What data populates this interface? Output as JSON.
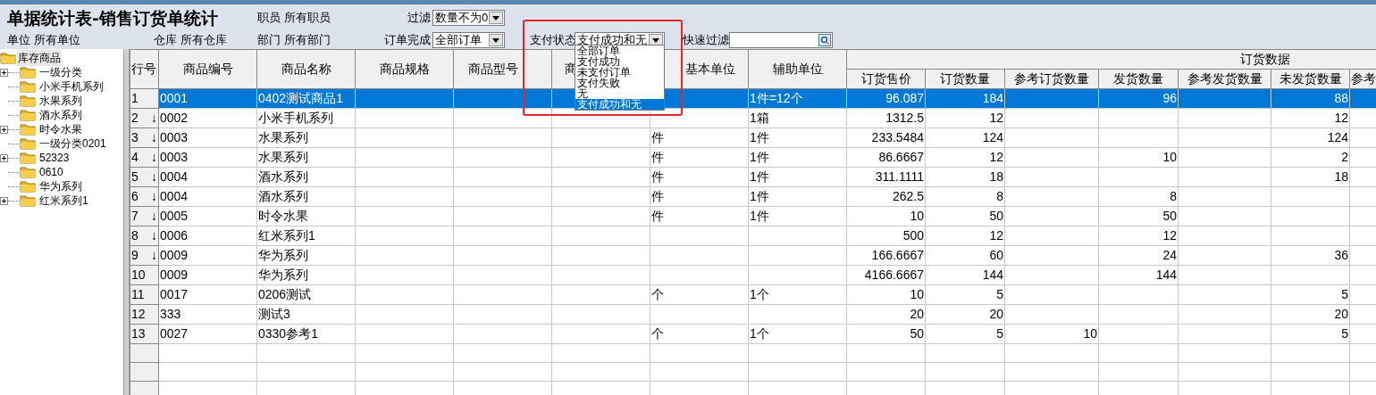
{
  "title": "单据统计表-销售订货单统计",
  "filters": [
    {
      "kind": "text",
      "label": "职员",
      "value": "所有职员"
    },
    {
      "kind": "select",
      "label": "过滤",
      "value": "数量不为0"
    },
    {
      "kind": "text",
      "label": "单位",
      "value": "所有单位"
    },
    {
      "kind": "text",
      "label": "仓库",
      "value": "所有仓库"
    },
    {
      "kind": "text",
      "label": "部门",
      "value": "所有部门"
    },
    {
      "kind": "select",
      "label": "订单完成",
      "value": "全部订单"
    },
    {
      "kind": "select",
      "label": "支付状态",
      "value": "支付成功和无"
    },
    {
      "kind": "search",
      "label": "快速过滤"
    }
  ],
  "dropdown": {
    "options": [
      {
        "label": "全部订单",
        "selected": false
      },
      {
        "label": "支付成功",
        "selected": false
      },
      {
        "label": "未支付订单",
        "selected": false
      },
      {
        "label": "支付失败",
        "selected": false
      },
      {
        "label": "无",
        "selected": false
      },
      {
        "label": "支付成功和无",
        "selected": true
      }
    ]
  },
  "tree": {
    "label": "库存商品",
    "selected": true,
    "children": [
      {
        "label": "一级分类",
        "expandable": true
      },
      {
        "label": "小米手机系列",
        "expandable": false
      },
      {
        "label": "水果系列",
        "expandable": false
      },
      {
        "label": "酒水系列",
        "expandable": false
      },
      {
        "label": "时令水果",
        "expandable": true
      },
      {
        "label": "一级分类0201",
        "expandable": false
      },
      {
        "label": "52323",
        "expandable": true
      },
      {
        "label": "0610",
        "expandable": false
      },
      {
        "label": "华为系列",
        "expandable": false
      },
      {
        "label": "红米系列1",
        "expandable": true
      }
    ]
  },
  "table": {
    "group_header": "订货数据",
    "columns": [
      "行号",
      "商品编号",
      "商品名称",
      "商品规格",
      "商品型号",
      "商",
      "基本单位",
      "辅助单位",
      "订货售价",
      "订货数量",
      "参考订货数量",
      "发货数量",
      "参考发货数量",
      "未发货数量",
      "参考"
    ],
    "rows": [
      {
        "selected": true,
        "cells": [
          "1",
          "0001",
          "0402测试商品1",
          "",
          "",
          "",
          "",
          "1件=12个",
          "96.087",
          "184",
          "",
          "96",
          "",
          "88",
          ""
        ]
      },
      {
        "selected": false,
        "marker": "↓",
        "cells": [
          "2",
          "0002",
          "小米手机系列",
          "",
          "",
          "",
          "",
          "1箱",
          "1312.5",
          "12",
          "",
          "",
          "",
          "12",
          ""
        ]
      },
      {
        "selected": false,
        "marker": "↓",
        "cells": [
          "3",
          "0003",
          "水果系列",
          "",
          "",
          "",
          "件",
          "1件",
          "233.5484",
          "124",
          "",
          "",
          "",
          "124",
          ""
        ]
      },
      {
        "selected": false,
        "marker": "↓",
        "cells": [
          "4",
          "0003",
          "水果系列",
          "",
          "",
          "",
          "件",
          "1件",
          "86.6667",
          "12",
          "",
          "10",
          "",
          "2",
          ""
        ]
      },
      {
        "selected": false,
        "marker": "↓",
        "cells": [
          "5",
          "0004",
          "酒水系列",
          "",
          "",
          "",
          "件",
          "1件",
          "311.1111",
          "18",
          "",
          "",
          "",
          "18",
          ""
        ]
      },
      {
        "selected": false,
        "marker": "↓",
        "cells": [
          "6",
          "0004",
          "酒水系列",
          "",
          "",
          "",
          "件",
          "1件",
          "262.5",
          "8",
          "",
          "8",
          "",
          "",
          ""
        ]
      },
      {
        "selected": false,
        "marker": "↓",
        "cells": [
          "7",
          "0005",
          "时令水果",
          "",
          "",
          "",
          "件",
          "1件",
          "10",
          "50",
          "",
          "50",
          "",
          "",
          ""
        ]
      },
      {
        "selected": false,
        "marker": "↓",
        "cells": [
          "8",
          "0006",
          "红米系列1",
          "",
          "",
          "",
          "",
          "",
          "500",
          "12",
          "",
          "12",
          "",
          "",
          ""
        ]
      },
      {
        "selected": false,
        "marker": "↓",
        "cells": [
          "9",
          "0009",
          "华为系列",
          "",
          "",
          "",
          "",
          "",
          "166.6667",
          "60",
          "",
          "24",
          "",
          "36",
          ""
        ]
      },
      {
        "selected": false,
        "cells": [
          "10",
          "0009",
          "华为系列",
          "",
          "",
          "",
          "",
          "",
          "4166.6667",
          "144",
          "",
          "144",
          "",
          "",
          ""
        ]
      },
      {
        "selected": false,
        "cells": [
          "11",
          "0017",
          "0206测试",
          "",
          "",
          "",
          "个",
          "1个",
          "10",
          "5",
          "",
          "",
          "",
          "5",
          ""
        ]
      },
      {
        "selected": false,
        "cells": [
          "12",
          "333",
          "测试3",
          "",
          "",
          "",
          "",
          "",
          "20",
          "20",
          "",
          "",
          "",
          "20",
          ""
        ]
      },
      {
        "selected": false,
        "cells": [
          "13",
          "0027",
          "0330参考1",
          "",
          "",
          "",
          "个",
          "1个",
          "50",
          "5",
          "10",
          "",
          "",
          "5",
          ""
        ]
      }
    ]
  }
}
